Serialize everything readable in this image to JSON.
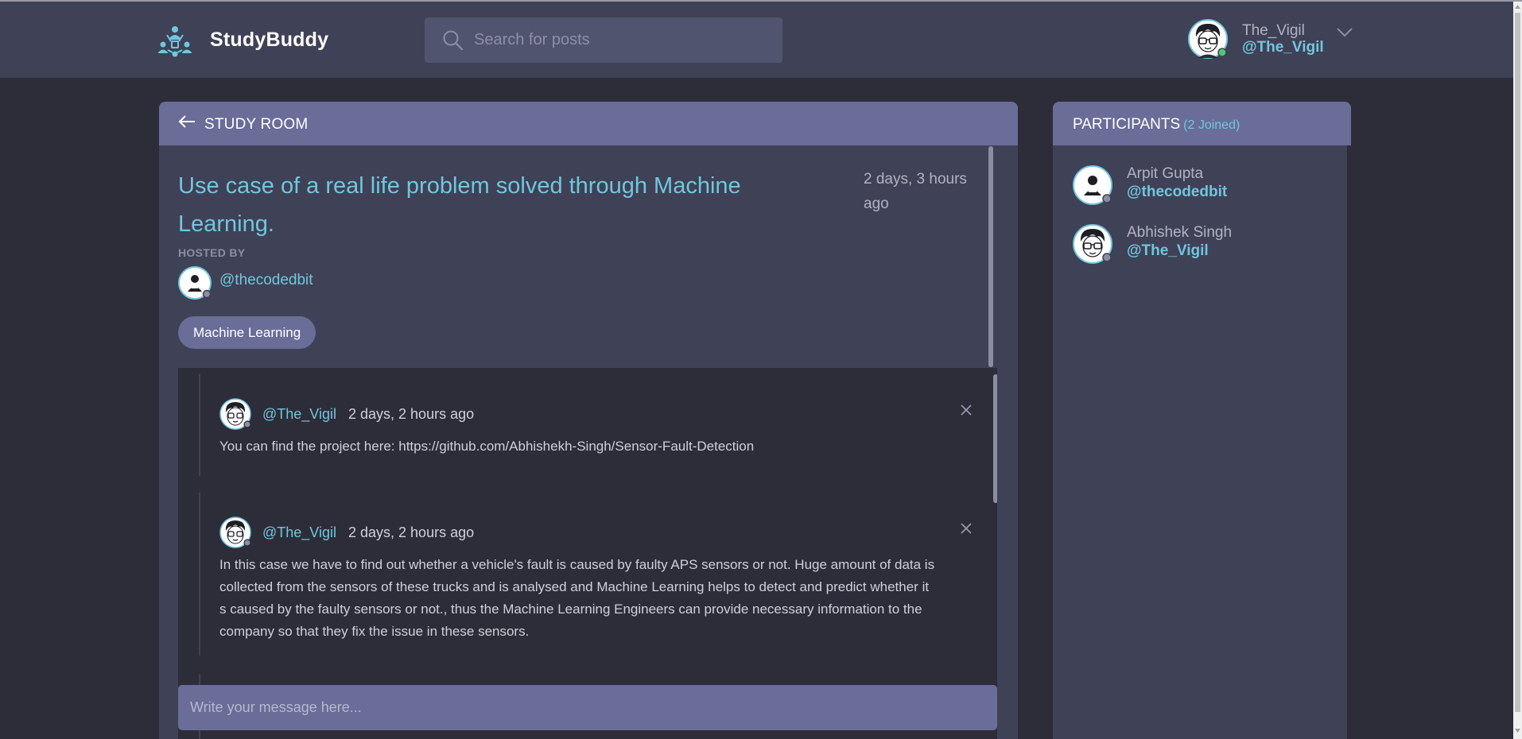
{
  "header": {
    "brand": "StudyBuddy",
    "search_placeholder": "Search for posts",
    "user": {
      "name": "The_Vigil",
      "handle": "@The_Vigil",
      "status": "online"
    }
  },
  "room": {
    "header_label": "STUDY ROOM",
    "title": "Use case of a real life problem solved through Machine Learning.",
    "created": "2 days, 3 hours ago",
    "hosted_by_label": "HOSTED BY",
    "host_handle": "@thecodedbit",
    "topic": "Machine Learning",
    "messages": [
      {
        "handle": "@The_Vigil",
        "time": "2 days, 2 hours ago",
        "body": "You can find the project here: https://github.com/Abhishekh-Singh/Sensor-Fault-Detection"
      },
      {
        "handle": "@The_Vigil",
        "time": "2 days, 2 hours ago",
        "body": "In this case we have to find out whether a vehicle's fault is caused by faulty APS sensors or not. Huge amount of data is collected from the sensors of these trucks and is analysed and Machine Learning helps to detect and predict whether it s caused by the faulty sensors or not., thus the Machine Learning Engineers can provide necessary information to the company so that they fix the issue in these sensors."
      }
    ],
    "message_placeholder": "Write your message here..."
  },
  "participants": {
    "title": "PARTICIPANTS",
    "count_label": "(2 Joined)",
    "list": [
      {
        "name": "Arpit Gupta",
        "handle": "@thecodedbit"
      },
      {
        "name": "Abhishek Singh",
        "handle": "@The_Vigil"
      }
    ]
  },
  "colors": {
    "background": "#2d2d39",
    "panel": "#3f4156",
    "panel_header": "#696d97",
    "accent": "#71c6dd",
    "online": "#4ecb71",
    "offline": "#8b8da3"
  }
}
